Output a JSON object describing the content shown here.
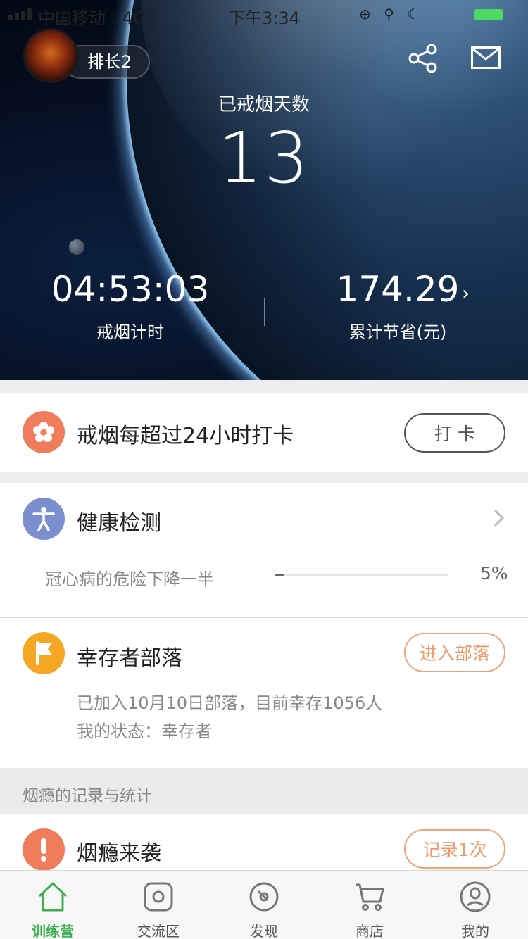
{
  "status_bar": {
    "carrier": "中国移动",
    "network": "4G",
    "time": "下午3:34",
    "icons": "⊕ ⚲ ☾"
  },
  "header": {
    "username": "排长2",
    "days_label": "已戒烟天数",
    "days_value": "13",
    "timer_value": "04:53:03",
    "timer_label": "戒烟计时",
    "saved_value": "174.29",
    "saved_label": "累计节省(元)",
    "saved_arrow": "›"
  },
  "checkin": {
    "title": "戒烟每超过24小时打卡",
    "button_label": "打  卡"
  },
  "health": {
    "title": "健康检测",
    "progress_label": "冠心病的危险下降一半",
    "progress_percent": 5,
    "progress_text": "5%"
  },
  "tribe": {
    "title": "幸存者部落",
    "button_label": "进入部落",
    "line1": "已加入10月10日部落，目前幸存1056人",
    "line2": "我的状态：幸存者"
  },
  "section": {
    "title": "烟瘾的记录与统计"
  },
  "craving": {
    "title": "烟瘾来袭",
    "button_label": "记录1次"
  },
  "tabbar": {
    "tabs": [
      {
        "label": "训练营",
        "icon": "home-icon",
        "active": true
      },
      {
        "label": "交流区",
        "icon": "camera-icon",
        "active": false
      },
      {
        "label": "发现",
        "icon": "compass-icon",
        "active": false
      },
      {
        "label": "商店",
        "icon": "cart-icon",
        "active": false
      },
      {
        "label": "我的",
        "icon": "user-icon",
        "active": false
      }
    ]
  },
  "colors": {
    "accent_green": "#3fae53",
    "checkin_orange": "#f07c5c",
    "health_blue": "#7a8ed0",
    "tribe_orange": "#f5a623",
    "button_orange": "#f0a27a"
  }
}
